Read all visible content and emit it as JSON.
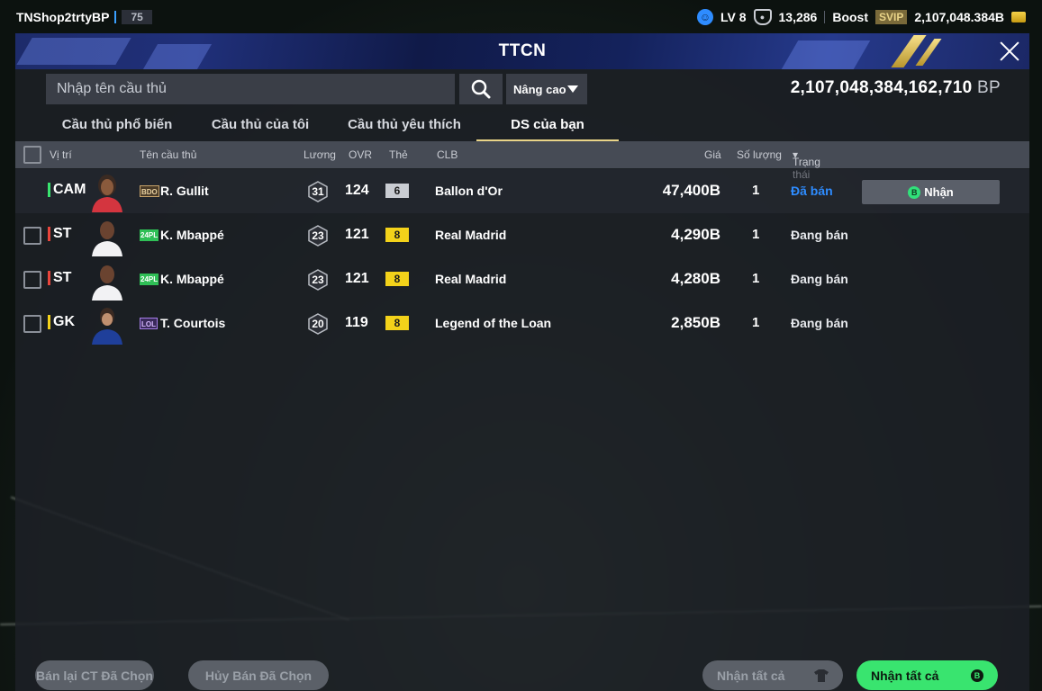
{
  "topbar": {
    "username": "TNShop2trtyBP",
    "user_level": "75",
    "level_label": "LV 8",
    "points": "13,286",
    "boost_label": "Boost",
    "svip_label": "SVIP",
    "bp_balance": "2,107,048.384B"
  },
  "panel": {
    "title": "TTCN"
  },
  "search": {
    "placeholder": "Nhập tên cầu thủ",
    "advanced_label": "Nâng cao",
    "bp_total": "2,107,048,384,162,710",
    "bp_unit": "BP"
  },
  "tabs": [
    {
      "label": "Cầu thủ phổ biến"
    },
    {
      "label": "Cầu thủ của tôi"
    },
    {
      "label": "Cầu thủ yêu thích"
    },
    {
      "label": "DS của bạn"
    }
  ],
  "table": {
    "headers": {
      "position": "Vị trí",
      "name": "Tên cầu thủ",
      "salary": "Lương",
      "ovr": "OVR",
      "card": "Thẻ",
      "club": "CLB",
      "price": "Giá",
      "quantity": "Số lượng",
      "status": "Trạng thái"
    },
    "rows": [
      {
        "position": "CAM",
        "season": "BDO",
        "name": "R. Gullit",
        "salary": "31",
        "ovr": "124",
        "card": "6",
        "club": "Ballon d'Or",
        "price": "47,400B",
        "quantity": "1",
        "status": "Đã bán",
        "action": "Nhận"
      },
      {
        "position": "ST",
        "season": "24PL",
        "name": "K. Mbappé",
        "salary": "23",
        "ovr": "121",
        "card": "8",
        "club": "Real Madrid",
        "price": "4,290B",
        "quantity": "1",
        "status": "Đang bán"
      },
      {
        "position": "ST",
        "season": "24PL",
        "name": "K. Mbappé",
        "salary": "23",
        "ovr": "121",
        "card": "8",
        "club": "Real Madrid",
        "price": "4,280B",
        "quantity": "1",
        "status": "Đang bán"
      },
      {
        "position": "GK",
        "season": "LOL",
        "name": "T. Courtois",
        "salary": "20",
        "ovr": "119",
        "card": "8",
        "club": "Legend of the Loan",
        "price": "2,850B",
        "quantity": "1",
        "status": "Đang bán"
      }
    ]
  },
  "bottom": {
    "resell_selected": "Bán lại CT Đã Chọn",
    "cancel_selected": "Hủy Bán Đã Chọn",
    "claim_all_dim": "Nhận tất cả",
    "claim_all": "Nhận tất cả"
  },
  "colors": {
    "accent_green": "#39e46f",
    "sold_blue": "#2e8cff",
    "tab_underline": "#e9d488",
    "pos_green": "#39e46f",
    "pos_red": "#e8453c",
    "pos_yellow": "#f3d21a"
  }
}
